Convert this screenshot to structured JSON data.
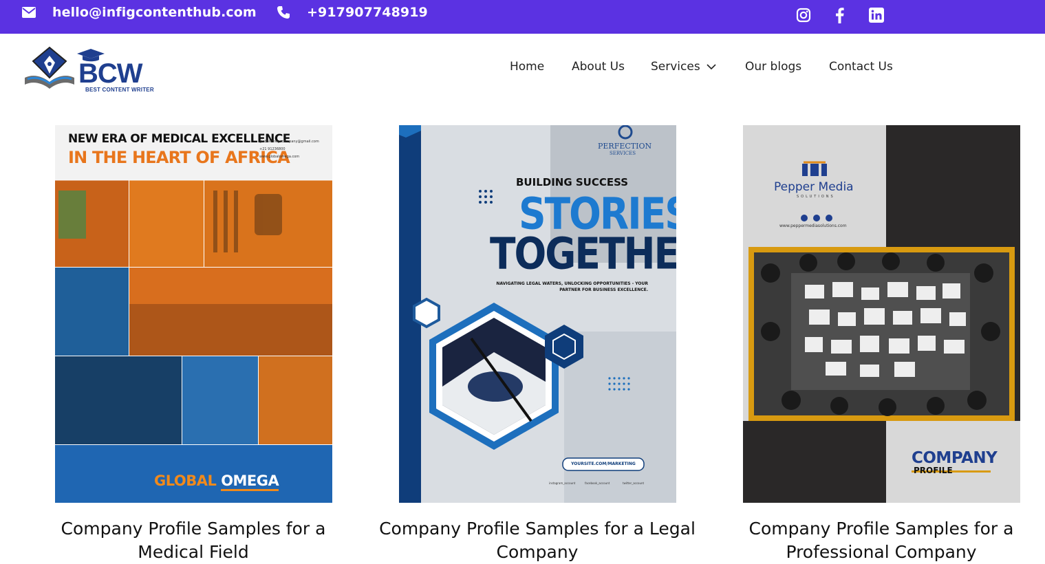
{
  "topbar": {
    "email": "hello@infigcontenthub.com",
    "phone": "+917907748919",
    "background": "#5b32e2",
    "icons": [
      "envelope-icon",
      "phone-icon",
      "instagram-icon",
      "facebook-icon",
      "linkedin-icon"
    ]
  },
  "header": {
    "logo_text": "BCW",
    "logo_tagline": "BEST CONTENT WRITER",
    "nav": {
      "home": "Home",
      "about": "About Us",
      "services": "Services",
      "blogs": "Our blogs",
      "contact": "Contact Us"
    }
  },
  "cards": [
    {
      "title": "Company Profile Samples for a Medical Field",
      "poster": {
        "headline1": "NEW ERA OF MEDICAL EXCELLENCE",
        "headline2": "IN THE HEART OF AFRICA",
        "contact1": "globalomegacompany@gmail.com",
        "contact2": "+21 91236800",
        "contact3": "www.globalomega.com",
        "brand1": "GLOBAL",
        "brand2": "OMEGA"
      }
    },
    {
      "title": "Company Profile Samples for a Legal Company",
      "poster": {
        "brand": "PERFECTION",
        "brand_sub": "SERVICES",
        "line1": "BUILDING SUCCESS",
        "line2": "STORIES",
        "line3": "TOGETHER",
        "tagline": "NAVIGATING LEGAL WATERS, UNLOCKING OPPORTUNITIES - YOUR PARTNER FOR BUSINESS EXCELLENCE.",
        "url": "YOURSITE.COM/MARKETING",
        "social1": "instagram_account",
        "social2": "facebook_account",
        "social3": "twitter_account"
      }
    },
    {
      "title": "Company Profile Samples for a Professional Company",
      "poster": {
        "brand": "Pepper Media",
        "brand_sub": "SOLUTIONS",
        "url": "www.peppermediasolutions.com",
        "word1": "COMPANY",
        "word2": "PROFILE"
      }
    }
  ]
}
